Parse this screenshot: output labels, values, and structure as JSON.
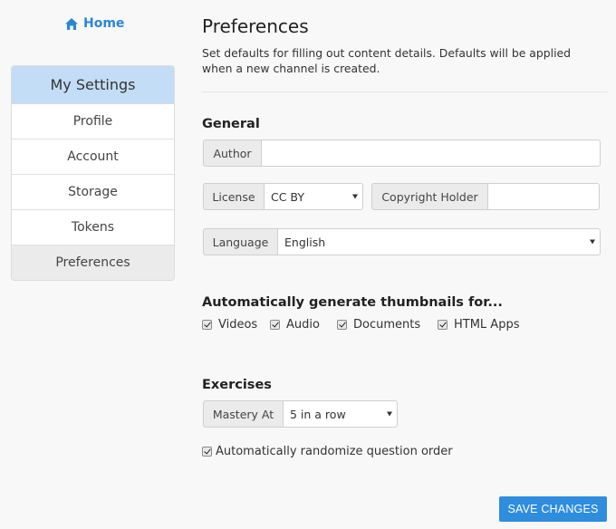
{
  "nav": {
    "home_label": "Home",
    "home_icon": "home-icon"
  },
  "sidebar": {
    "title": "My Settings",
    "items": [
      {
        "label": "Profile",
        "active": false
      },
      {
        "label": "Account",
        "active": false
      },
      {
        "label": "Storage",
        "active": false
      },
      {
        "label": "Tokens",
        "active": false
      },
      {
        "label": "Preferences",
        "active": true
      }
    ]
  },
  "main": {
    "title": "Preferences",
    "description": "Set defaults for filling out content details. Defaults will be applied when a new channel is created.",
    "general": {
      "heading": "General",
      "author_label": "Author",
      "author_value": "",
      "license_label": "License",
      "license_value": "CC BY",
      "copyright_label": "Copyright Holder",
      "copyright_value": "",
      "language_label": "Language",
      "language_value": "English"
    },
    "thumbnails": {
      "heading": "Automatically generate thumbnails for...",
      "options": [
        {
          "label": "Videos",
          "checked": true
        },
        {
          "label": "Audio",
          "checked": true
        },
        {
          "label": "Documents",
          "checked": true
        },
        {
          "label": "HTML Apps",
          "checked": true
        }
      ]
    },
    "exercises": {
      "heading": "Exercises",
      "mastery_label": "Mastery At",
      "mastery_value": "5 in a row",
      "randomize_label": "Automatically randomize question order",
      "randomize_checked": true
    },
    "save_label": "SAVE CHANGES"
  },
  "colors": {
    "accent": "#2e8ddd",
    "sidebar_header_bg": "#c3ddf6",
    "active_item_bg": "#ebebeb"
  }
}
